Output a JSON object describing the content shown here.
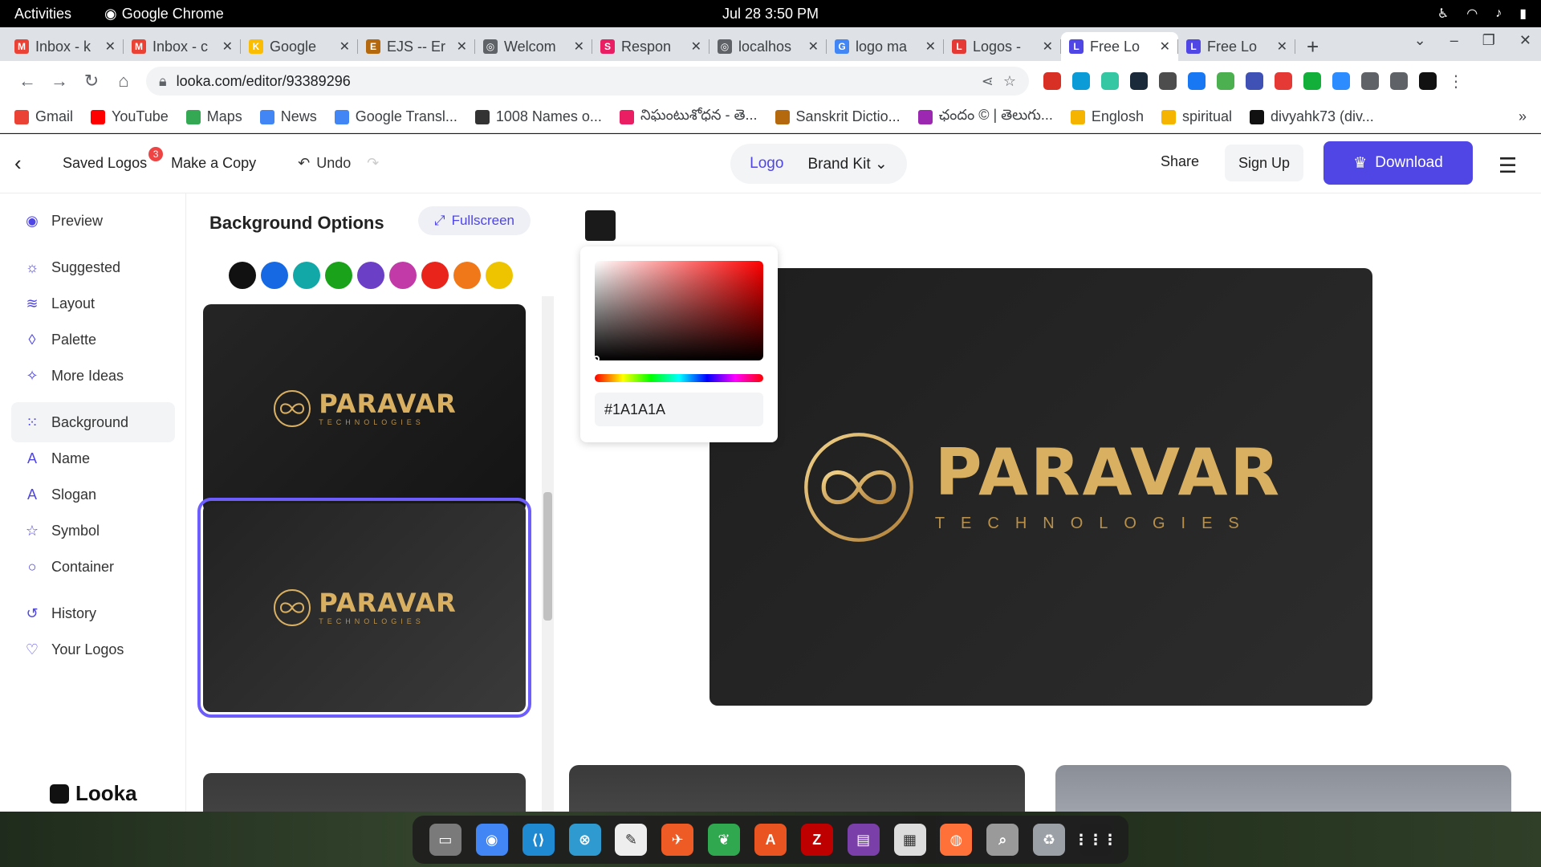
{
  "topbar": {
    "activities": "Activities",
    "app_name": "Google Chrome",
    "clock": "Jul 28  3:50 PM"
  },
  "tabs": [
    {
      "title": "Inbox - k",
      "fav_color": "#ea4335",
      "fav": "M"
    },
    {
      "title": "Inbox - c",
      "fav_color": "#ea4335",
      "fav": "M"
    },
    {
      "title": "Google",
      "fav_color": "#fbbc04",
      "fav": "K"
    },
    {
      "title": "EJS -- Er",
      "fav_color": "#b4690e",
      "fav": "E"
    },
    {
      "title": "Welcom",
      "fav_color": "#5f6368",
      "fav": "◎"
    },
    {
      "title": "Respon",
      "fav_color": "#e91e63",
      "fav": "S"
    },
    {
      "title": "localhos",
      "fav_color": "#5f6368",
      "fav": "◎"
    },
    {
      "title": "logo ma",
      "fav_color": "#4285f4",
      "fav": "G"
    },
    {
      "title": "Logos -",
      "fav_color": "#e53935",
      "fav": "L"
    },
    {
      "title": "Free Lo",
      "fav_color": "#4f46e5",
      "fav": "L",
      "active": true
    },
    {
      "title": "Free Lo",
      "fav_color": "#4f46e5",
      "fav": "L"
    }
  ],
  "omnibox": {
    "url": "looka.com/editor/93389296"
  },
  "bookmarks": [
    {
      "label": "Gmail",
      "color": "#ea4335"
    },
    {
      "label": "YouTube",
      "color": "#ff0000"
    },
    {
      "label": "Maps",
      "color": "#34a853"
    },
    {
      "label": "News",
      "color": "#4285f4"
    },
    {
      "label": "Google Transl...",
      "color": "#4285f4"
    },
    {
      "label": "1008 Names o...",
      "color": "#333333"
    },
    {
      "label": "నిఘంటుశోధన - తె...",
      "color": "#e91e63"
    },
    {
      "label": "Sanskrit Dictio...",
      "color": "#b4690e"
    },
    {
      "label": "ఛందం © | తెలుగు...",
      "color": "#9c27b0"
    },
    {
      "label": "Englosh",
      "color": "#f4b400"
    },
    {
      "label": "spiritual",
      "color": "#f4b400"
    },
    {
      "label": "divyahk73 (div...",
      "color": "#111111"
    }
  ],
  "header": {
    "saved_logos": "Saved Logos",
    "saved_count": "3",
    "make_copy": "Make a Copy",
    "undo": "Undo",
    "logo_tab": "Logo",
    "brand_kit": "Brand Kit",
    "share": "Share",
    "sign_up": "Sign Up",
    "download": "Download"
  },
  "sidebar": {
    "items": [
      {
        "label": "Preview",
        "icon": "eye-icon",
        "glyph": "◉"
      },
      {
        "label": "Suggested",
        "icon": "bulb-icon",
        "glyph": "☼"
      },
      {
        "label": "Layout",
        "icon": "layers-icon",
        "glyph": "≋"
      },
      {
        "label": "Palette",
        "icon": "drop-icon",
        "glyph": "◊"
      },
      {
        "label": "More Ideas",
        "icon": "wand-icon",
        "glyph": "✧"
      },
      {
        "label": "Background",
        "icon": "grid-icon",
        "glyph": "⁙",
        "active": true
      },
      {
        "label": "Name",
        "icon": "name-icon",
        "glyph": "A"
      },
      {
        "label": "Slogan",
        "icon": "slogan-icon",
        "glyph": "A"
      },
      {
        "label": "Symbol",
        "icon": "star-icon",
        "glyph": "☆"
      },
      {
        "label": "Container",
        "icon": "circle-icon",
        "glyph": "○"
      },
      {
        "label": "History",
        "icon": "history-icon",
        "glyph": "↺"
      },
      {
        "label": "Your Logos",
        "icon": "heart-icon",
        "glyph": "♡"
      }
    ],
    "brand": "Looka"
  },
  "bgpanel": {
    "title": "Background Options",
    "fullscreen": "Fullscreen",
    "swatches": [
      "#111111",
      "#1668e3",
      "#12a8a8",
      "#1aa31a",
      "#6b3fc6",
      "#c23aa8",
      "#e8241b",
      "#f07818",
      "#eec400"
    ]
  },
  "logo": {
    "name": "PARAVAR",
    "tagline": "TECHNOLOGIES"
  },
  "picker": {
    "hex": "#1A1A1A",
    "current_color": "#1a1a1a"
  },
  "dock": [
    {
      "name": "files-icon",
      "color": "#7a7a7a",
      "glyph": "▭"
    },
    {
      "name": "chrome-icon",
      "color": "#4285f4",
      "glyph": "◉"
    },
    {
      "name": "vscode-icon",
      "color": "#1f8ad2",
      "glyph": "⟨⟩"
    },
    {
      "name": "network-icon",
      "color": "#2e9ad0",
      "glyph": "⊗"
    },
    {
      "name": "inkscape-icon",
      "color": "#eeeeee",
      "glyph": "✎"
    },
    {
      "name": "postman-icon",
      "color": "#ef5b25",
      "glyph": "✈"
    },
    {
      "name": "mongodb-icon",
      "color": "#2fa84f",
      "glyph": "❦"
    },
    {
      "name": "software-icon",
      "color": "#e95420",
      "glyph": "A"
    },
    {
      "name": "filezilla-icon",
      "color": "#bf0000",
      "glyph": "Z"
    },
    {
      "name": "video-icon",
      "color": "#7a3fa8",
      "glyph": "▤"
    },
    {
      "name": "document-icon",
      "color": "#dddddd",
      "glyph": "▦"
    },
    {
      "name": "firefox-icon",
      "color": "#ff7139",
      "glyph": "◍"
    },
    {
      "name": "search-app-icon",
      "color": "#9a9a9a",
      "glyph": "⌕"
    },
    {
      "name": "trash-icon",
      "color": "#9aa0a6",
      "glyph": "♻"
    },
    {
      "name": "apps-grid-icon",
      "color": "#1e1e1e",
      "glyph": "⋮⋮⋮"
    }
  ]
}
